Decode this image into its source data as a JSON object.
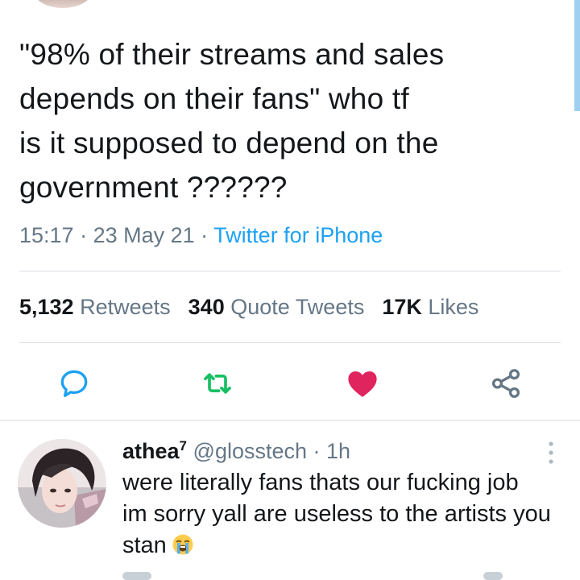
{
  "tweet": {
    "text": "\"98% of their streams and sales\ndepends on their fans\" who tf\nis it supposed to depend on the\ngovernment ??????",
    "time": "15:17",
    "date": "23 May 21",
    "separator": " · ",
    "source": "Twitter for iPhone"
  },
  "stats": {
    "retweets_count": "5,132",
    "retweets_label": "Retweets",
    "quotes_count": "340",
    "quotes_label": "Quote Tweets",
    "likes_count": "17K",
    "likes_label": "Likes"
  },
  "actions": {
    "reply_icon": "reply-icon",
    "retweet_icon": "retweet-icon",
    "like_icon": "heart-icon",
    "share_icon": "share-icon",
    "liked": true
  },
  "reply": {
    "name": "athea",
    "name_sup": "7",
    "handle": "@glosstech",
    "separator": " · ",
    "time": "1h",
    "text": "were literally fans thats our fucking job\nim sorry yall are useless to the artists you\nstan",
    "emoji": "loudly-crying-face"
  },
  "colors": {
    "text": "#14171a",
    "muted": "#657786",
    "link": "#1da1f2",
    "reply_icon": "#1da1f2",
    "retweet_icon": "#17bf63",
    "like_icon": "#e0245e",
    "share_icon": "#657786",
    "divider": "#d8dde1"
  }
}
